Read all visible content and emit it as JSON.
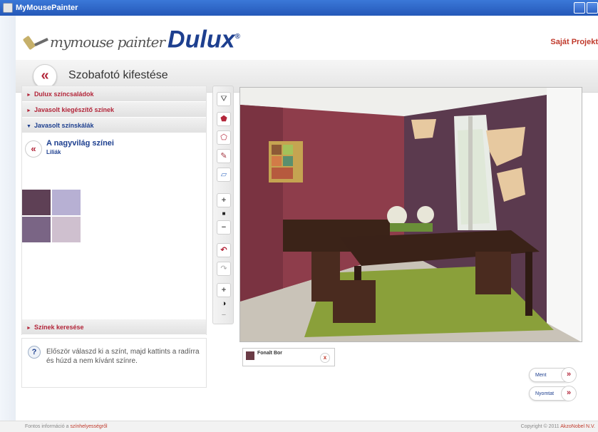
{
  "window": {
    "title": "MyMousePainter"
  },
  "header": {
    "logo_script": "mymouse painter",
    "logo_brand": "Dulux",
    "logo_reg": "®",
    "projects_link": "Saját Projekt"
  },
  "subbar": {
    "back_icon": "«",
    "title": "Szobafotó kifestése"
  },
  "accordion": {
    "items": [
      {
        "label": "Dulux színcsaládok",
        "arrow": "►"
      },
      {
        "label": "Javasolt kiegészítő színek",
        "arrow": "►"
      },
      {
        "label": "Javasolt színskálák",
        "arrow": "▼"
      }
    ],
    "search": {
      "label": "Színek keresése",
      "arrow": "►"
    }
  },
  "palette": {
    "back_icon": "«",
    "title": "A nagyvilág színei",
    "subtitle": "Liliák",
    "swatches": [
      "#5e4055",
      "#b7b0d3",
      "#7a6585",
      "#cfc0cf"
    ]
  },
  "help": {
    "icon": "?",
    "text": "Először válaszd ki a színt, majd kattints a radírra és húzd a nem kívánt színre."
  },
  "toolbar": {
    "tools": [
      {
        "name": "paint-bucket-icon",
        "glyph": "⛛"
      },
      {
        "name": "polygon-fill-icon",
        "glyph": "⬟"
      },
      {
        "name": "polygon-outline-icon",
        "glyph": "⬠"
      },
      {
        "name": "brush-icon",
        "glyph": "✎"
      },
      {
        "name": "eraser-icon",
        "glyph": "▱"
      },
      {
        "name": "zoom-in-icon",
        "glyph": "+"
      },
      {
        "name": "brush-size-icon",
        "glyph": "■"
      },
      {
        "name": "zoom-out-icon",
        "glyph": "−"
      },
      {
        "name": "undo-icon",
        "glyph": "↶"
      },
      {
        "name": "redo-icon",
        "glyph": "↷"
      },
      {
        "name": "contrast-plus-icon",
        "glyph": "+"
      },
      {
        "name": "contrast-icon",
        "glyph": "◑"
      },
      {
        "name": "contrast-minus-icon",
        "glyph": "−"
      }
    ]
  },
  "chips": [
    {
      "label": "Fonalt Bor",
      "color": "#6a3b45",
      "remove": "x"
    }
  ],
  "actions": {
    "save": {
      "label": "Ment",
      "go": "»"
    },
    "print": {
      "label": "Nyomtat",
      "go": "»"
    }
  },
  "footer": {
    "left_text": "Fontos információ a",
    "left_link": "színhelyességről",
    "right_text": "Copyright © 2011",
    "right_link": "AkzoNobel N.V."
  },
  "colors": {
    "accent_red": "#b3263a",
    "brand_blue": "#1d3f8f",
    "wall_paint": "#5b3a4e",
    "wall_red": "#8e3d4b"
  }
}
